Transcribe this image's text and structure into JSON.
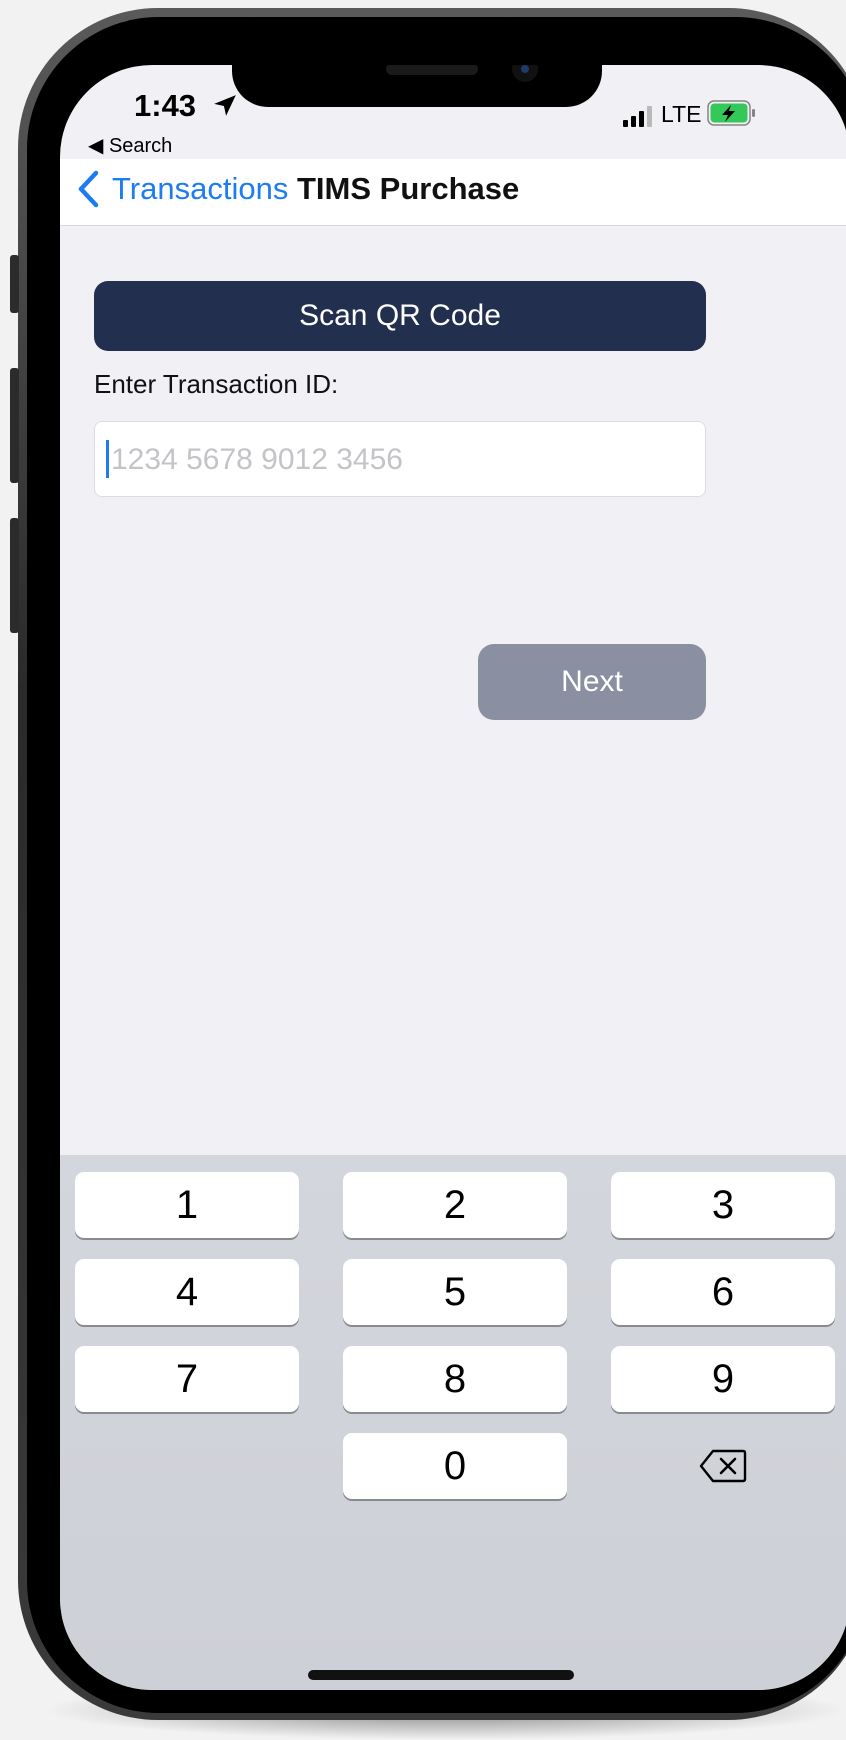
{
  "status_bar": {
    "time": "1:43",
    "back_to_app": "◀ Search",
    "network": "LTE",
    "icons": [
      "location-arrow-icon",
      "signal-bars-icon",
      "battery-charging-icon"
    ]
  },
  "nav": {
    "back_label": "Transactions",
    "title": "TIMS Purchase"
  },
  "main": {
    "scan_button_label": "Scan QR Code",
    "field_label": "Enter Transaction ID:",
    "transaction_id_value": "",
    "transaction_id_placeholder": "1234 5678 9012 3456",
    "next_button_label": "Next"
  },
  "keyboard": {
    "keys": [
      "1",
      "2",
      "3",
      "4",
      "5",
      "6",
      "7",
      "8",
      "9",
      "0"
    ],
    "delete_icon": "delete-backspace-icon"
  },
  "colors": {
    "link_blue": "#1c7cf2",
    "scan_button_bg": "#222f4f",
    "next_button_bg_disabled": "#8a90a2",
    "screen_bg": "#f1f0f5",
    "battery_green": "#34c759"
  }
}
